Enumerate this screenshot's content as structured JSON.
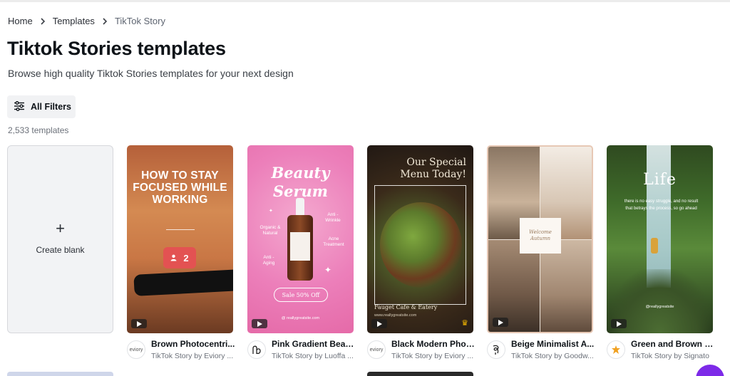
{
  "breadcrumb": {
    "home": "Home",
    "templates": "Templates",
    "current": "TikTok Story"
  },
  "page": {
    "title": "Tiktok Stories templates",
    "subtitle": "Browse high quality Tiktok Stories templates for your next design"
  },
  "filters": {
    "label": "All Filters"
  },
  "results": {
    "count": "2,533 templates"
  },
  "create_blank": {
    "icon": "plus-icon",
    "label": "Create blank"
  },
  "cards": [
    {
      "title": "Brown Photocentri...",
      "sub": "TikTok Story by Eviory ...",
      "avatar": "eviory",
      "thumb": {
        "text": "HOW TO STAY FOCUSED WHILE WORKING",
        "badge": "2"
      },
      "premium": false
    },
    {
      "title": "Pink Gradient Beau...",
      "sub": "TikTok Story by Luoffa ...",
      "avatar": "luoffa-logo",
      "thumb": {
        "title_line1": "Beauty",
        "title_line2": "Serum",
        "organic": "Organic & Natural",
        "anti_wrinkle": "Anti - Wrinkle",
        "acne": "Acne Treatment",
        "anti_aging": "Anti - Aging",
        "sale": "Sale 50% Off",
        "handle": "@ reallygreatsite.com"
      },
      "premium": false
    },
    {
      "title": "Black Modern Phot...",
      "sub": "TikTok Story by Eviory ...",
      "avatar": "eviory",
      "thumb": {
        "title_line1": "Our Special",
        "title_line2": "Menu Today!",
        "cafe": "Fauget Cafe & Eatery",
        "site": "www.reallygreatsite.com"
      },
      "premium": true
    },
    {
      "title": "Beige Minimalist A...",
      "sub": "TikTok Story by Goodw...",
      "avatar": "goodw-logo",
      "thumb": {
        "line1": "Welcome",
        "line2": "Autumn"
      },
      "premium": false
    },
    {
      "title": "Green and Brown S...",
      "sub": "TikTok Story by Signato",
      "avatar": "signato-logo",
      "thumb": {
        "title": "Life",
        "quote": "there is no easy struggle, and no result that betrays the process, so go ahead",
        "handle": "@reallygreatsite"
      },
      "premium": false
    }
  ],
  "colors": {
    "brand_purple": "#7d2ae8",
    "premium_crown": "#f5b800",
    "notif_red": "#e35252"
  }
}
